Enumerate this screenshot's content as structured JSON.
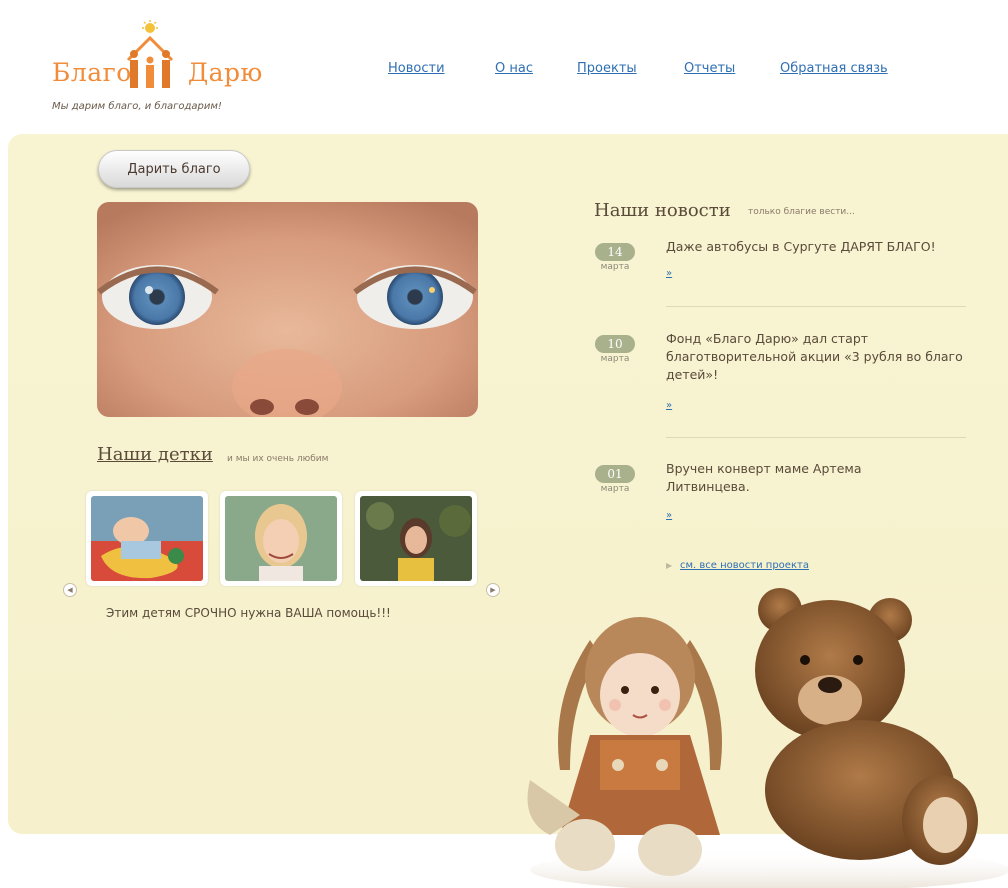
{
  "header": {
    "logo_left": "Благо",
    "logo_right": "Дарю",
    "logo_tagline": "Мы дарим благо, и благодарим!",
    "nav": [
      {
        "label": "Новости"
      },
      {
        "label": "О нас"
      },
      {
        "label": "Проекты"
      },
      {
        "label": "Отчеты"
      },
      {
        "label": "Обратная связь"
      }
    ]
  },
  "main": {
    "give_button": "Дарить благо",
    "kids": {
      "title": "Наши детки",
      "subtitle": "и мы их очень любим",
      "help_text": "Этим детям СРОЧНО нужна ВАША помощь!!!"
    },
    "news": {
      "title": "Наши новости",
      "subtitle": "только благие вести...",
      "items": [
        {
          "day": "14",
          "month": "марта",
          "text": "Даже автобусы в Сургуте ДАРЯТ БЛАГО!",
          "more": "»"
        },
        {
          "day": "10",
          "month": "марта",
          "text": "Фонд «Благо Дарю» дал старт благотворительной акции «3 рубля во благо детей»!",
          "more": "»"
        },
        {
          "day": "01",
          "month": "марта",
          "text": "Вручен конверт маме Артема Литвинцева.",
          "more": "»"
        }
      ],
      "all_link": "см. все новости проекта"
    }
  },
  "colors": {
    "accent": "#f08c3a",
    "link": "#2f6fb3",
    "panel": "#f8f4d2",
    "date_pill": "#a8b08c"
  }
}
